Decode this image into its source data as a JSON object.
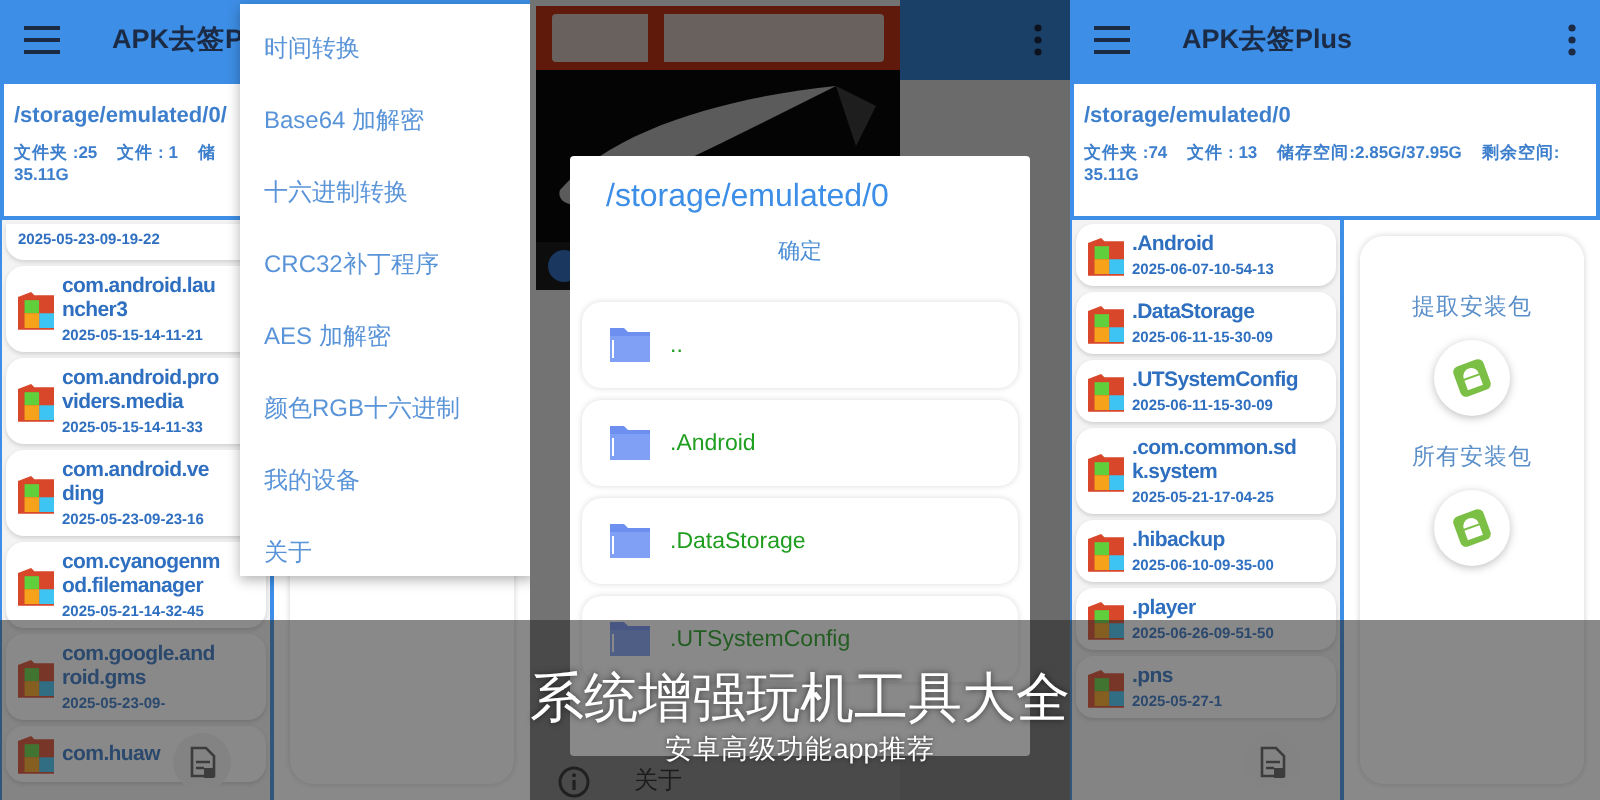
{
  "left_screen": {
    "app_bar": {
      "title": "APK去签P"
    },
    "path": "/storage/emulated/0/",
    "stats": [
      "文件夹 :25",
      "文件 : 1",
      "储"
    ],
    "free": "35.11G",
    "files": [
      {
        "date": "2025-05-23-09-19-22"
      },
      {
        "name_lines": [
          "com.android.lau",
          "ncher3"
        ],
        "date": "2025-05-15-14-11-21"
      },
      {
        "name_lines": [
          "com.android.pro",
          "viders.media"
        ],
        "date": "2025-05-15-14-11-33"
      },
      {
        "name_lines": [
          "com.android.ve",
          "ding"
        ],
        "date": "2025-05-23-09-23-16"
      },
      {
        "name_lines": [
          "com.cyanogenm",
          "od.filemanager"
        ],
        "date": "2025-05-21-14-32-45"
      },
      {
        "name_lines": [
          "com.google.and",
          "roid.gms"
        ],
        "date": "2025-05-23-09-"
      },
      {
        "name_lines": [
          "com.huaw"
        ]
      }
    ],
    "popup_menu": [
      "时间转换",
      "Base64 加解密",
      "十六进制转换",
      "CRC32补丁程序",
      "AES 加解密",
      "颜色RGB十六进制",
      "我的设备",
      "关于"
    ]
  },
  "middle_screen": {
    "drawer": {
      "header": {
        "kind": "picture"
      },
      "items": [
        "关于"
      ]
    },
    "dialog": {
      "title": "/storage/emulated/0",
      "confirm": "确定",
      "folders": [
        "..",
        ".Android",
        ".DataStorage",
        ".UTSystemConfig"
      ]
    }
  },
  "right_screen": {
    "app_bar": {
      "title": "APK去签Plus"
    },
    "path": "/storage/emulated/0",
    "stats": [
      "文件夹 :74",
      "文件 : 13",
      "储存空间:2.85G/37.95G",
      "剩余空间:"
    ],
    "free": "35.11G",
    "files": [
      {
        "name_lines": [
          ".Android"
        ],
        "date": "2025-06-07-10-54-13"
      },
      {
        "name_lines": [
          ".DataStorage"
        ],
        "date": "2025-06-11-15-30-09"
      },
      {
        "name_lines": [
          ".UTSystemConfig"
        ],
        "date": "2025-06-11-15-30-09"
      },
      {
        "name_lines": [
          ".com.common.sd",
          "k.system"
        ],
        "date": "2025-05-21-17-04-25"
      },
      {
        "name_lines": [
          ".hibackup"
        ],
        "date": "2025-06-10-09-35-00"
      },
      {
        "name_lines": [
          ".player"
        ],
        "date": "2025-06-26-09-51-50"
      },
      {
        "name_lines": [
          ".pns"
        ],
        "date": "2025-05-27-1"
      }
    ],
    "actions": [
      "提取安装包",
      "所有安装包"
    ]
  },
  "banner": {
    "title": "系统增强玩机工具大全",
    "subtitle": "安卓高级功能app推荐"
  }
}
